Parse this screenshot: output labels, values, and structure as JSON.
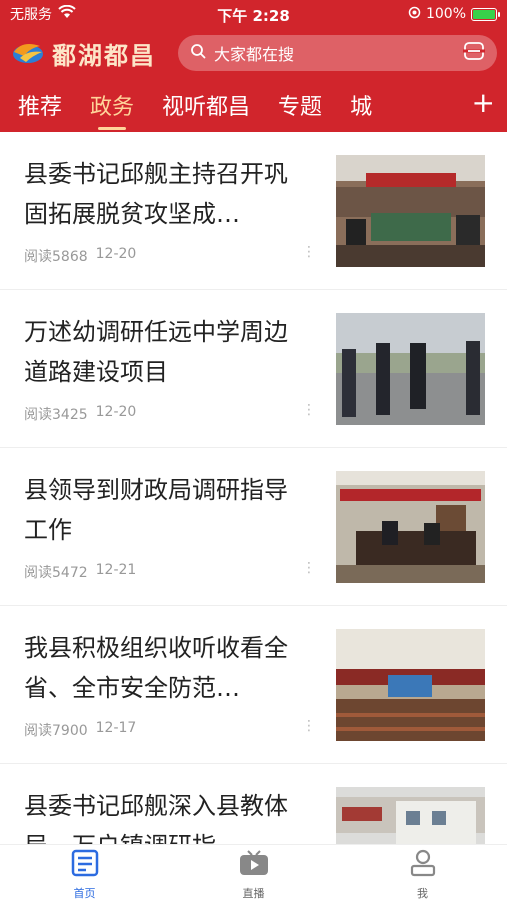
{
  "status_bar": {
    "carrier": "无服务",
    "time": "下午 2:28",
    "battery": "100%"
  },
  "app": {
    "name": "鄱湖都昌"
  },
  "search": {
    "placeholder": "大家都在搜"
  },
  "tabs": [
    {
      "label": "推荐",
      "active": false
    },
    {
      "label": "政务",
      "active": true
    },
    {
      "label": "视听都昌",
      "active": false
    },
    {
      "label": "专题",
      "active": false
    },
    {
      "label": "城",
      "active": false
    }
  ],
  "tab_add": "+",
  "articles": [
    {
      "title": "县委书记邱舰主持召开巩固拓展脱贫攻坚成…",
      "reads": "阅读5868",
      "date": "12-20",
      "image": "meeting-room-photo"
    },
    {
      "title": "万述幼调研任远中学周边道路建设项目",
      "reads": "阅读3425",
      "date": "12-20",
      "image": "officials-on-road-photo"
    },
    {
      "title": "县领导到财政局调研指导工作",
      "reads": "阅读5472",
      "date": "12-21",
      "image": "meeting-banner-photo"
    },
    {
      "title": "我县积极组织收听收看全省、全市安全防范…",
      "reads": "阅读7900",
      "date": "12-17",
      "image": "auditorium-photo"
    },
    {
      "title": "县委书记邱舰深入县教体局、万户镇调研指",
      "reads": "",
      "date": "",
      "image": "school-building-photo"
    }
  ],
  "more_glyph": "⋮",
  "bottom_nav": [
    {
      "label": "首页",
      "icon": "news-home-icon",
      "active": true
    },
    {
      "label": "直播",
      "icon": "live-tv-icon",
      "active": false
    },
    {
      "label": "我",
      "icon": "user-profile-icon",
      "active": false
    }
  ],
  "colors": {
    "brand_red": "#d1252c",
    "active_tab": "#ffd49a",
    "nav_active": "#2c6be0"
  }
}
